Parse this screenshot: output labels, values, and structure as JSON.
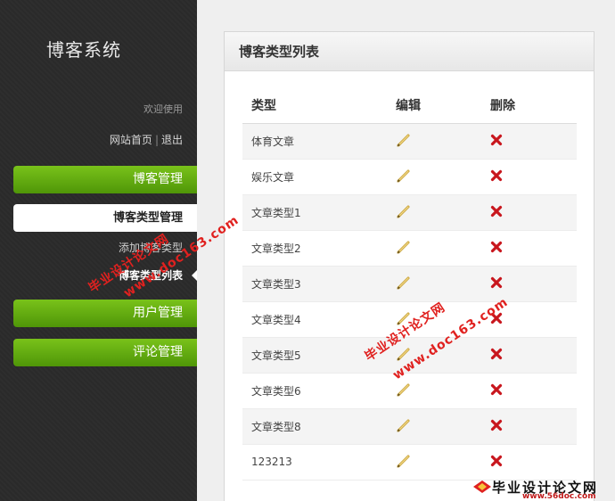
{
  "sidebar": {
    "brand": "博客系统",
    "welcome": "欢迎使用",
    "home_link": "网站首页",
    "separator": "|",
    "logout_link": "退出",
    "nav_blog": "博客管理",
    "nav_blog_types": "博客类型管理",
    "sub_add": "添加博客类型",
    "sub_list": "博客类型列表",
    "nav_users": "用户管理",
    "nav_comments": "评论管理"
  },
  "panel": {
    "title": "博客类型列表",
    "headers": {
      "type": "类型",
      "edit": "编辑",
      "delete": "删除"
    },
    "rows": [
      {
        "type": "体育文章"
      },
      {
        "type": "娱乐文章"
      },
      {
        "type": "文章类型1"
      },
      {
        "type": "文章类型2"
      },
      {
        "type": "文章类型3"
      },
      {
        "type": "文章类型4"
      },
      {
        "type": "文章类型5"
      },
      {
        "type": "文章类型6"
      },
      {
        "type": "文章类型8"
      },
      {
        "type": "123213"
      }
    ]
  },
  "icons": {
    "edit": "pencil-icon",
    "delete": "red-x-icon"
  },
  "colors": {
    "nav_green": "#5faa10",
    "sidebar_bg": "#2b2b2b",
    "delete_red": "#c8161d",
    "watermark_red": "#e0211f"
  },
  "watermark": {
    "cn": "毕业设计论文网",
    "url": "www.doc163.com",
    "footer_cn": "毕业设计论文网",
    "footer_url": "www.56doc.com"
  }
}
